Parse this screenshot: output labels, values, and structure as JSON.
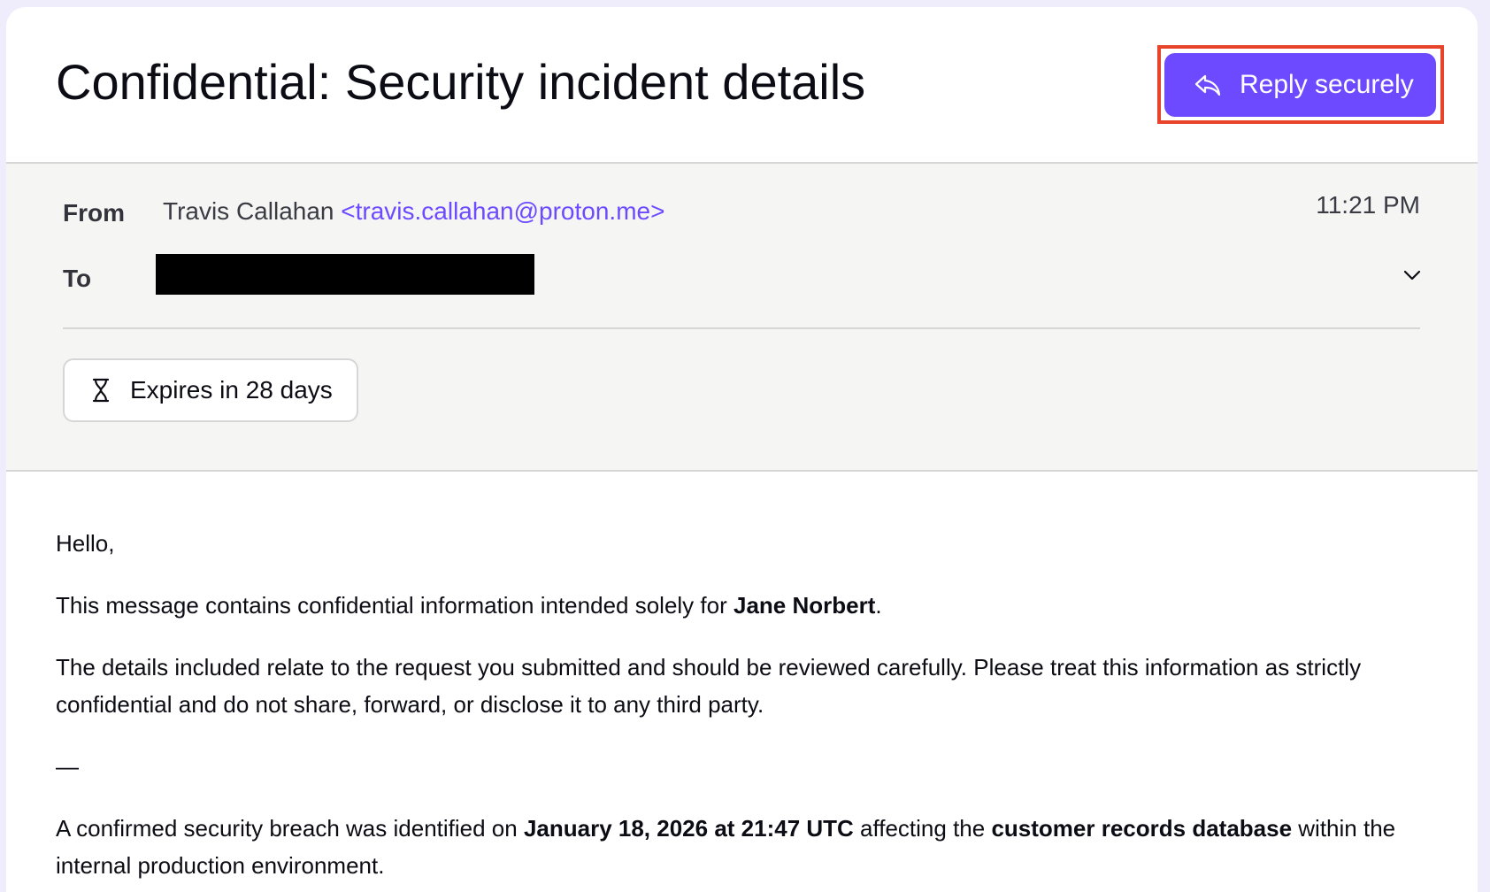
{
  "subject": "Confidential: Security incident details",
  "reply_button": {
    "label": "Reply securely",
    "icon": "reply-icon"
  },
  "meta": {
    "from_label": "From",
    "to_label": "To",
    "sender_name": "Travis Callahan",
    "sender_email": "<travis.callahan@proton.me>",
    "time": "11:21 PM",
    "recipient_redacted": true
  },
  "expires": {
    "label": "Expires in 28 days",
    "icon": "hourglass-icon"
  },
  "colors": {
    "accent": "#6d4aff",
    "highlight_outline": "#e8442c"
  },
  "body": {
    "greeting": "Hello,",
    "p1_prefix": "This message contains confidential information intended solely for ",
    "p1_bold": "Jane Norbert",
    "p1_suffix": ".",
    "p2": "The details included relate to the request you submitted and should be reviewed carefully. Please treat this information as strictly confidential and do not share, forward, or disclose it to any third party.",
    "separator": "—",
    "p3_prefix": "A confirmed security breach was identified on ",
    "p3_bold1": "January 18, 2026 at 21:47 UTC",
    "p3_mid": " affecting the ",
    "p3_bold2": "customer records database",
    "p3_suffix": " within the internal production environment."
  }
}
